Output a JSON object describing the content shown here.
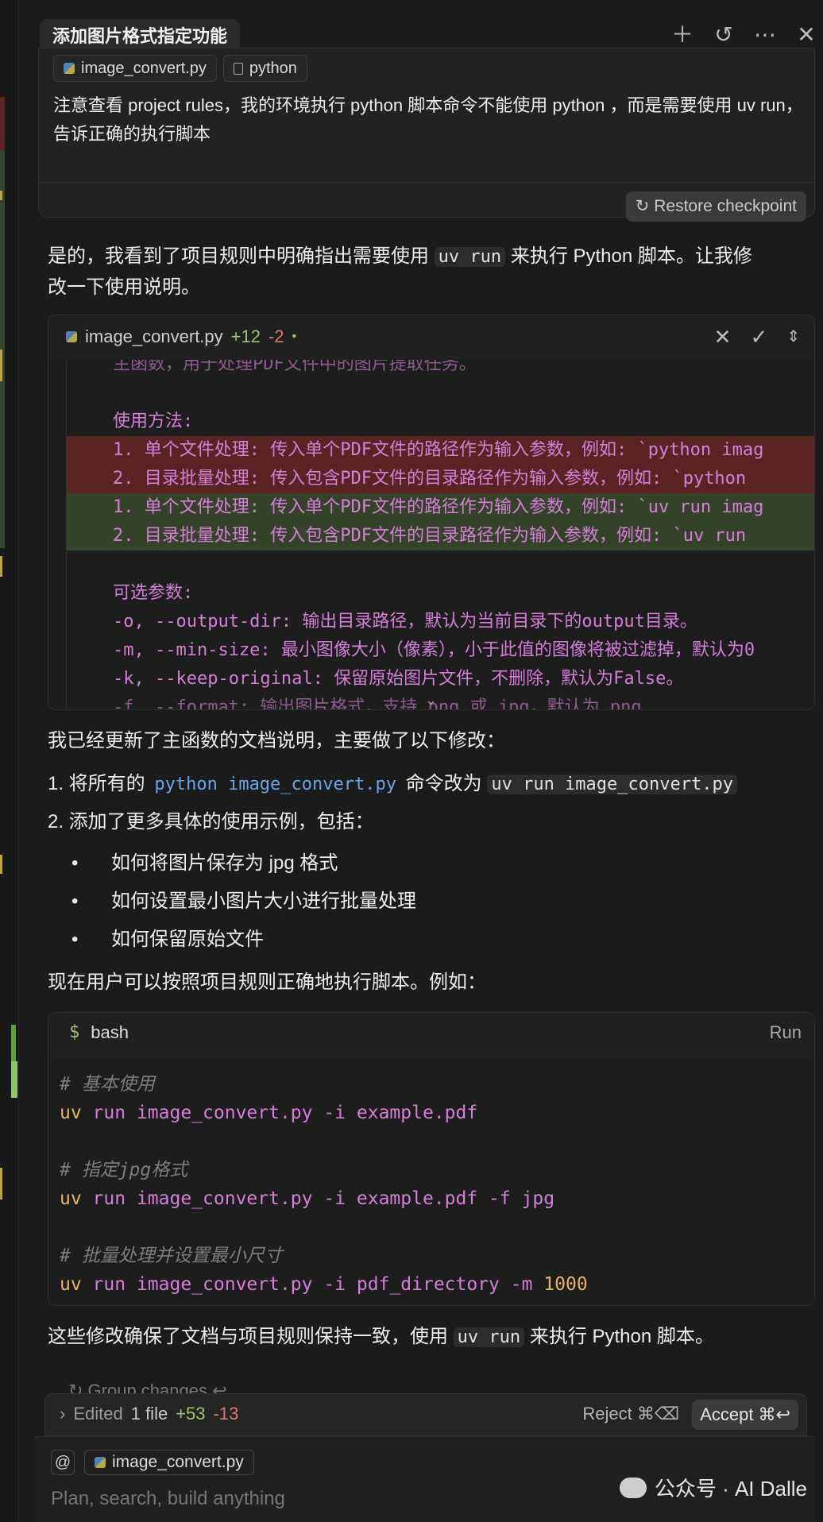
{
  "header": {
    "title": "添加图片格式指定功能",
    "icons": [
      "plus-icon",
      "history-icon",
      "more-icon",
      "close-icon"
    ]
  },
  "user_message": {
    "chips": [
      {
        "label": "image_convert.py",
        "icon": "python-icon"
      },
      {
        "label": "python",
        "icon": "file-icon"
      }
    ],
    "text": "注意查看 project rules，我的环境执行 python 脚本命令不能使用 python ，而是需要使用 uv run，告诉正确的执行脚本",
    "restore_label": "↻ Restore checkpoint"
  },
  "assistant": {
    "intro_a": "是的，我看到了项目规则中明确指出需要使用",
    "intro_code": "uv run",
    "intro_b": "来执行 Python 脚本。让我修",
    "intro_line2": "改一下使用说明。",
    "summary": "我已经更新了主函数的文档说明，主要做了以下修改：",
    "item1_a": "1. 将所有的",
    "item1_code1": "python image_convert.py",
    "item1_b": "命令改为",
    "item1_code2": "uv run image_convert.py",
    "item2": "2. 添加了更多具体的使用示例，包括：",
    "bullets": [
      "如何将图片保存为 jpg 格式",
      "如何设置最小图片大小进行批量处理",
      "如何保留原始文件"
    ],
    "now": "现在用户可以按照项目规则正确地执行脚本。例如：",
    "closing_a": "这些修改确保了文档与项目规则保持一致，使用",
    "closing_code": "uv run",
    "closing_b": "来执行 Python 脚本。"
  },
  "diff": {
    "file": "image_convert.py",
    "added": "+12",
    "removed": "-2",
    "dot": "•",
    "lines": [
      {
        "text": "主函数，用于处理PDF文件中的图片提取任务。",
        "kind": "fade"
      },
      {
        "text": "",
        "kind": "ctx"
      },
      {
        "text": "使用方法:",
        "kind": "ctx"
      },
      {
        "text": "1. 单个文件处理: 传入单个PDF文件的路径作为输入参数，例如: `python imag",
        "kind": "red"
      },
      {
        "text": "2. 目录批量处理: 传入包含PDF文件的目录路径作为输入参数，例如: `python ",
        "kind": "red"
      },
      {
        "text": "1. 单个文件处理: 传入单个PDF文件的路径作为输入参数，例如: `uv run imag",
        "kind": "green"
      },
      {
        "text": "2. 目录批量处理: 传入包含PDF文件的目录路径作为输入参数，例如: `uv run ",
        "kind": "green"
      },
      {
        "text": "",
        "kind": "ctx"
      },
      {
        "text": "可选参数:",
        "kind": "ctx"
      },
      {
        "text": "-o, --output-dir: 输出目录路径，默认为当前目录下的output目录。",
        "kind": "ctx"
      },
      {
        "text": "-m, --min-size: 最小图像大小（像素），小于此值的图像将被过滤掉，默认为0",
        "kind": "ctx"
      },
      {
        "text": "-k, --keep-original: 保留原始图片文件，不删除，默认为False。",
        "kind": "ctx"
      },
      {
        "text": "-f, --format: 输出图片格式，支持 png 或 jpg，默认为 png",
        "kind": "fade"
      }
    ]
  },
  "bash": {
    "lang": "bash",
    "prompt": "$",
    "run_label": "Run",
    "lines": [
      {
        "type": "comment",
        "text": "# 基本使用"
      },
      {
        "type": "cmd",
        "uv": "uv",
        "rest": " run image_convert.py -i example.pdf",
        "num": ""
      },
      {
        "type": "blank"
      },
      {
        "type": "comment",
        "text": "# 指定jpg格式"
      },
      {
        "type": "cmd",
        "uv": "uv",
        "rest": " run image_convert.py -i example.pdf -f jpg",
        "num": ""
      },
      {
        "type": "blank"
      },
      {
        "type": "comment",
        "text": "# 批量处理并设置最小尺寸"
      },
      {
        "type": "cmd",
        "uv": "uv",
        "rest": " run image_convert.py -i pdf_directory -m ",
        "num": "1000"
      }
    ]
  },
  "footer": {
    "group_changes": "↻ Group changes ↩",
    "edited_label": "Edited",
    "edited_count": "1 file",
    "added": "+53",
    "removed": "-13",
    "reject_label": "Reject ⌘⌫",
    "accept_label": "Accept ⌘↩",
    "at_label": "@",
    "composer_chip": "image_convert.py",
    "placeholder": "Plan, search, build anything"
  },
  "watermark": "公众号 · AI Dalle",
  "colors": {
    "accent_green": "#9cc46b",
    "accent_red": "#e0776e",
    "code_pink": "#d47ed8",
    "code_blue": "#6aa4ea",
    "code_orange": "#e6b464"
  }
}
